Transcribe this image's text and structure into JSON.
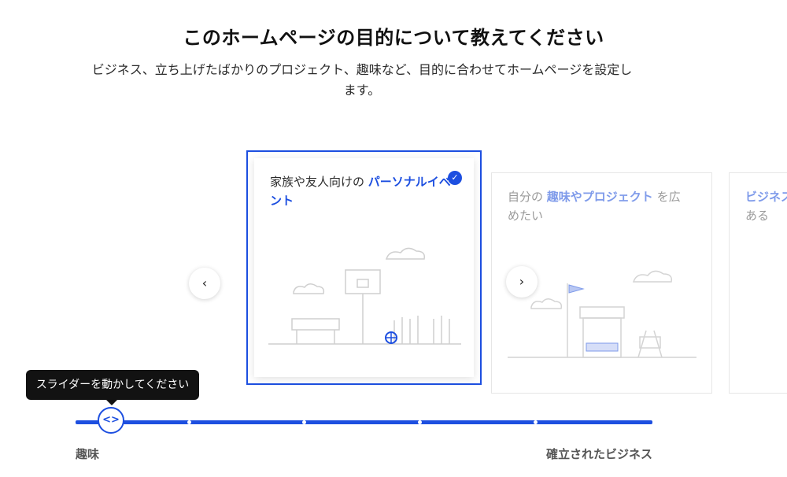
{
  "page": {
    "title": "このホームページの目的について教えてください",
    "subtitle": "ビジネス、立ち上げたばかりのプロジェクト、趣味など、目的に合わせてホームページを設定します。"
  },
  "cards": [
    {
      "prefix": "家族や友人向けの",
      "highlight": "パーソナルイベント",
      "suffix": "",
      "selected": true,
      "illustration": "basketball-court"
    },
    {
      "prefix": "自分の",
      "highlight": "趣味やプロジェクト",
      "suffix": "を広めたい",
      "selected": false,
      "illustration": "market-stand"
    },
    {
      "prefix": "",
      "highlight": "ビジネス",
      "suffix": "ある",
      "selected": false,
      "illustration": ""
    }
  ],
  "nav": {
    "prev_icon": "chevron-left-icon",
    "next_icon": "chevron-right-icon",
    "prev_glyph": "‹",
    "next_glyph": "›"
  },
  "slider": {
    "tooltip": "スライダーを動かしてください",
    "min_label": "趣味",
    "max_label": "確立されたビジネス",
    "handle_glyph": "<>",
    "steps": 5,
    "value_step": 0
  },
  "colors": {
    "accent": "#1d4fe0",
    "accent_muted": "#7f9bea"
  }
}
